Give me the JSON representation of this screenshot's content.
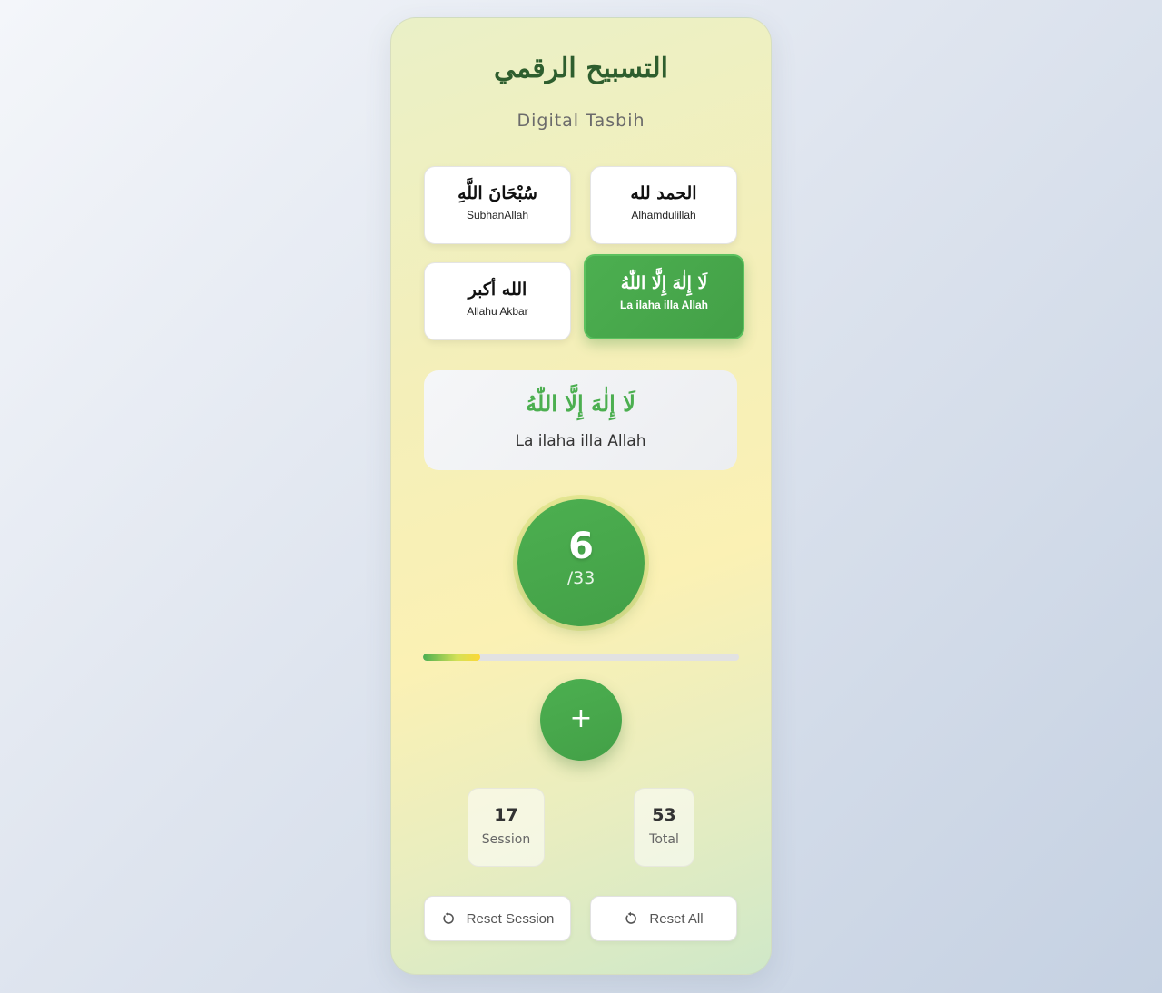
{
  "header": {
    "title_ar": "التسبيح الرقمي",
    "subtitle": "Digital Tasbih"
  },
  "dhikr_options": [
    {
      "arabic": "سُبْحَانَ اللَّهِ",
      "label": "SubhanAllah",
      "selected": false
    },
    {
      "arabic": "الحمد لله",
      "label": "Alhamdulillah",
      "selected": false
    },
    {
      "arabic": "الله أكبر",
      "label": "Allahu Akbar",
      "selected": false
    },
    {
      "arabic": "لَا إِلٰهَ إِلَّا اللّٰهُ",
      "label": "La ilaha illa Allah",
      "selected": true
    }
  ],
  "current_dhikr": {
    "arabic": "لَا إِلٰهَ إِلَّا اللّٰهُ",
    "label": "La ilaha illa Allah"
  },
  "counter": {
    "count": "6",
    "target": "/33",
    "progress_fraction": 0.18
  },
  "increment_button": {
    "label": "+"
  },
  "stats": {
    "session": {
      "value": "17",
      "label": "Session"
    },
    "total": {
      "value": "53",
      "label": "Total"
    }
  },
  "actions": {
    "reset_session_label": "Reset Session",
    "reset_all_label": "Reset All",
    "icon": "reset-icon"
  },
  "colors": {
    "accent": "#4caf50",
    "title": "#2e5e2e"
  }
}
